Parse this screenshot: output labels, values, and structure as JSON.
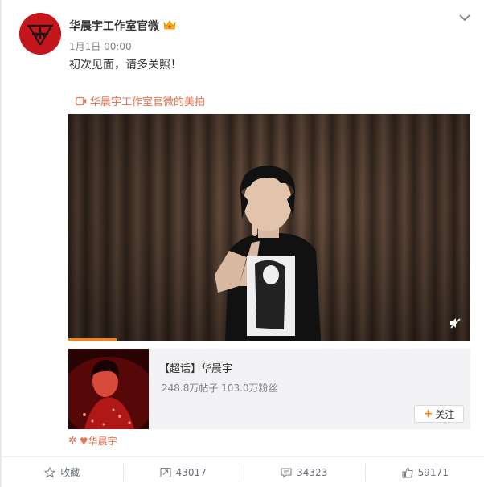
{
  "post": {
    "author": "华晨宇工作室官微",
    "timestamp": "1月1日 00:00",
    "text": "初次见面，请多关照！",
    "video_source_link": "华晨宇工作室官微的美拍",
    "video_progress": 0.12
  },
  "topic": {
    "title": "【超话】华晨宇",
    "stats": "248.8万帖子 103.0万粉丝",
    "follow_label": "关注",
    "follow_icon": "+"
  },
  "tag": {
    "label": "♥华晨宇"
  },
  "actions": {
    "favorite_label": "收藏",
    "repost_count": "43017",
    "comment_count": "34323",
    "like_count": "59171"
  },
  "colors": {
    "accent": "#eb7350",
    "orange": "#ff8200",
    "avatar_red": "#c4161c"
  }
}
